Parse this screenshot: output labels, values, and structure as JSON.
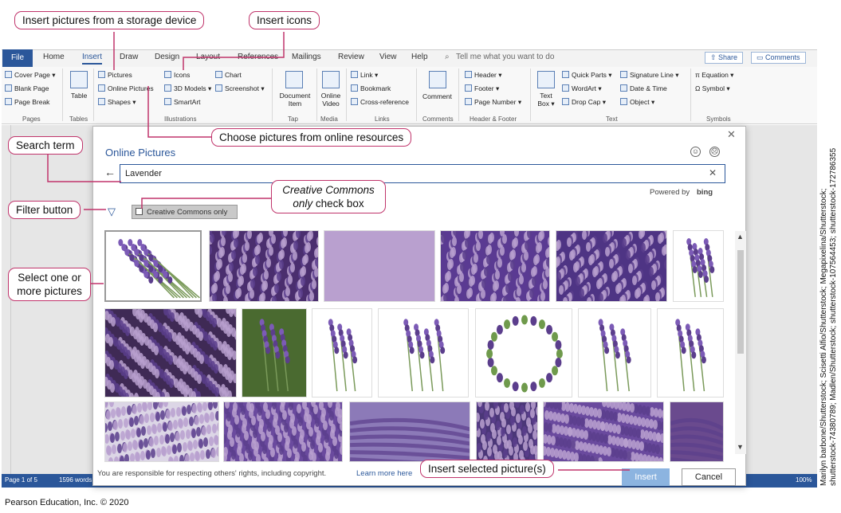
{
  "callouts": {
    "storage": "Insert pictures from a storage device",
    "icons": "Insert icons",
    "online": "Choose pictures from online resources",
    "search_term": "Search term",
    "cc_line1": "Creative Commons",
    "cc_line2_italic": "only",
    "cc_line2_rest": " check box",
    "filter": "Filter button",
    "select_line1": "Select one or",
    "select_line2": "more pictures",
    "insert_selected": "Insert selected picture(s)"
  },
  "ribbon": {
    "tabs": [
      "File",
      "Home",
      "Insert",
      "Draw",
      "Design",
      "Layout",
      "References",
      "Mailings",
      "Review",
      "View",
      "Help"
    ],
    "tell_me": "Tell me what you want to do",
    "share": "Share",
    "comments": "Comments",
    "pages": {
      "cover": "Cover Page",
      "blank": "Blank Page",
      "break": "Page Break",
      "label": "Pages"
    },
    "tables": {
      "table": "Table",
      "label": "Tables"
    },
    "illustrations": {
      "pictures": "Pictures",
      "online": "Online Pictures",
      "shapes": "Shapes",
      "icons": "Icons",
      "models": "3D Models",
      "smartart": "SmartArt",
      "chart": "Chart",
      "screenshot": "Screenshot",
      "label": "Illustrations"
    },
    "tap": {
      "doc_item_1": "Document",
      "doc_item_2": "Item",
      "label": "Tap"
    },
    "media": {
      "online_1": "Online",
      "online_2": "Video",
      "label": "Media"
    },
    "links": {
      "link": "Link",
      "bookmark": "Bookmark",
      "cross": "Cross-reference",
      "label": "Links"
    },
    "comments_grp": {
      "comment": "Comment",
      "label": "Comments"
    },
    "header_footer": {
      "header": "Header",
      "footer": "Footer",
      "page_number": "Page Number",
      "label": "Header & Footer"
    },
    "text": {
      "textbox_1": "Text",
      "textbox_2": "Box",
      "quick": "Quick Parts",
      "wordart": "WordArt",
      "dropcap": "Drop Cap",
      "sig": "Signature Line",
      "date": "Date & Time",
      "object": "Object",
      "label": "Text"
    },
    "symbols": {
      "equation": "Equation",
      "symbol": "Symbol",
      "label": "Symbols"
    }
  },
  "dialog": {
    "title": "Online Pictures",
    "search_value": "Lavender",
    "powered_by": "Powered by",
    "bing": "bing",
    "cc_only": "Creative Commons only",
    "rights": "You are responsible for respecting others' rights, including copyright.",
    "learn_more": "Learn more here",
    "insert": "Insert",
    "cancel": "Cancel"
  },
  "status": {
    "page": "Page 1 of 5",
    "words": "1596 words",
    "zoom": "100%"
  },
  "credits": {
    "bottom": "Pearson Education, Inc. © 2020",
    "side": "Marilyn barbone/Shutterstock; Scisetti Alfio/Shutterstock; Megapixelina/Shutterstock; shutterstock-74380789; Madlen/Shutterstock; shutterstock-107564453; shutterstock-172786355"
  },
  "colors": {
    "accent": "#2b579a",
    "callout_border": "#c0346b",
    "lavender_light": "#b9a0cf",
    "lavender_dark": "#5b3e8c"
  }
}
